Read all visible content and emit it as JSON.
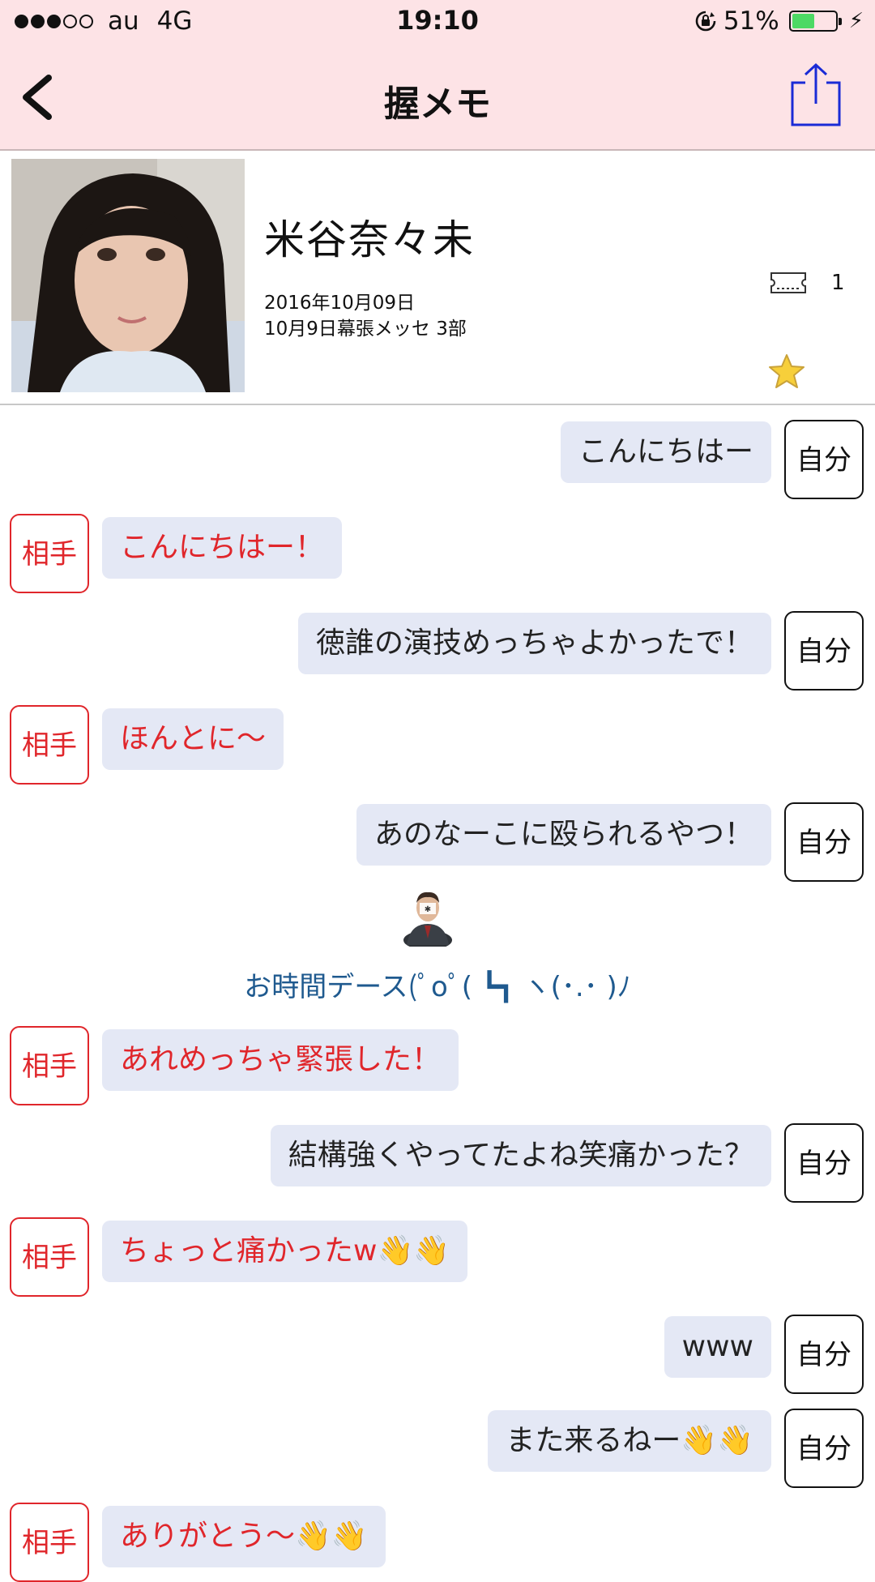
{
  "status_bar": {
    "carrier": "au",
    "network": "4G",
    "time": "19:10",
    "battery_percent": "51%",
    "battery_level": 0.51
  },
  "nav": {
    "title": "握メモ",
    "back_icon": "chevron-left-icon",
    "share_icon": "share-icon"
  },
  "profile": {
    "name": "米谷奈々未",
    "date": "2016年10月09日",
    "event": "10月9日幕張メッセ 3部",
    "ticket_count": "1"
  },
  "labels": {
    "self": "自分",
    "other": "相手"
  },
  "messages": [
    {
      "from": "self",
      "text": "こんにちはー"
    },
    {
      "from": "other",
      "text": "こんにちはー！"
    },
    {
      "from": "self",
      "text": "徳誰の演技めっちゃよかったで！"
    },
    {
      "from": "other",
      "text": "ほんとに〜"
    },
    {
      "from": "self",
      "text": "あのなーこに殴られるやつ！"
    },
    {
      "from": "staff",
      "text": "お時間デース(ﾟoﾟ( ┗┓ ヽ(･.･ )ﾉ"
    },
    {
      "from": "other",
      "text": "あれめっちゃ緊張した！"
    },
    {
      "from": "self",
      "text": "結構強くやってたよね笑痛かった？"
    },
    {
      "from": "other",
      "text": "ちょっと痛かったw👋👋"
    },
    {
      "from": "self",
      "text": "www"
    },
    {
      "from": "self",
      "text": "また来るねー👋👋"
    },
    {
      "from": "other",
      "text": "ありがとう〜👋👋"
    }
  ]
}
